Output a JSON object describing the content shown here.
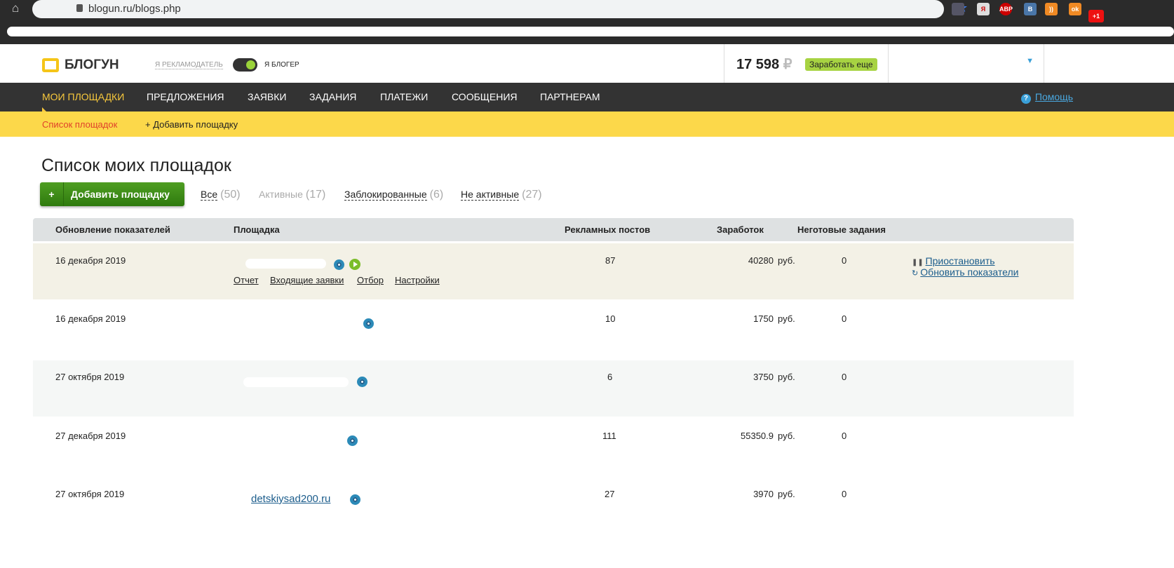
{
  "browser": {
    "url": "blogun.ru/blogs.php",
    "extensions": [
      "ABP",
      "B",
      "+1"
    ]
  },
  "header": {
    "logo": "БЛОГУН",
    "advertiser": "Я РЕКЛАМОДАТЕЛЬ",
    "blogger": "Я БЛОГЕР",
    "balance": "17 598",
    "currency": "₽",
    "earn_more": "Заработать еще"
  },
  "nav": {
    "items": [
      "МОИ ПЛОЩАДКИ",
      "ПРЕДЛОЖЕНИЯ",
      "ЗАЯВКИ",
      "ЗАДАНИЯ",
      "ПЛАТЕЖИ",
      "СООБЩЕНИЯ",
      "ПАРТНЕРАМ"
    ],
    "help": "Помощь"
  },
  "subnav": {
    "list": "Список площадок",
    "add": "+ Добавить площадку"
  },
  "page": {
    "title": "Список моих площадок",
    "add_button": "Добавить площадку",
    "add_plus": "+",
    "filters": [
      {
        "label": "Все",
        "count": "(50)"
      },
      {
        "label": "Активные",
        "count": "(17)"
      },
      {
        "label": "Заблокированные",
        "count": "(6)"
      },
      {
        "label": "Не активные",
        "count": "(27)"
      }
    ]
  },
  "table": {
    "headers": [
      "Обновление показателей",
      "Площадка",
      "Рекламных постов",
      "Заработок",
      "Неготовые задания"
    ],
    "currency": "руб.",
    "row_links": [
      "Отчет",
      "Входящие заявки",
      "Отбор",
      "Настройки"
    ],
    "actions": [
      "Приостановить",
      "Обновить показатели"
    ],
    "rows": [
      {
        "date": "16 декабря 2019",
        "site": "",
        "posts": "87",
        "earnings": "40280",
        "pending": "0"
      },
      {
        "date": "16 декабря 2019",
        "site": "",
        "posts": "10",
        "earnings": "1750",
        "pending": "0"
      },
      {
        "date": "27 октября 2019",
        "site": "",
        "posts": "6",
        "earnings": "3750",
        "pending": "0"
      },
      {
        "date": "27 декабря 2019",
        "site": "",
        "posts": "111",
        "earnings": "55350.9",
        "pending": "0"
      },
      {
        "date": "27 октября 2019",
        "site": "detskiysad200.ru",
        "posts": "27",
        "earnings": "3970",
        "pending": "0"
      }
    ]
  }
}
